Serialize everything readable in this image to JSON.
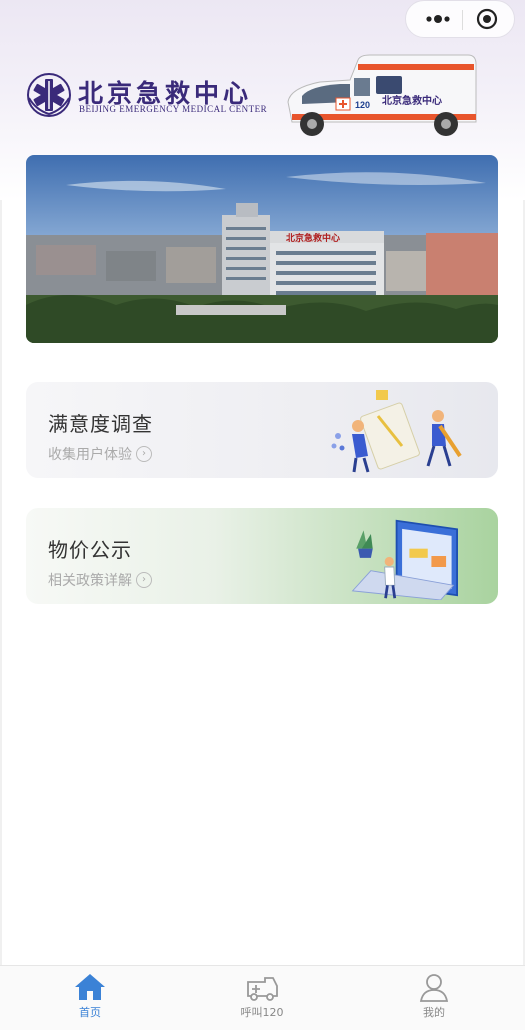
{
  "header": {
    "logo_text_cn": "北京急救中心",
    "logo_text_en": "BEIJING  EMERGENCY  MEDICAL  CENTER",
    "ambulance_text": "北京急救中心",
    "ambulance_number": "120"
  },
  "banner": {
    "building_sign": "北京急救中心"
  },
  "cards": [
    {
      "title": "满意度调查",
      "subtitle": "收集用户体验"
    },
    {
      "title": "物价公示",
      "subtitle": "相关政策详解"
    }
  ],
  "tabbar": {
    "items": [
      {
        "label": "首页",
        "icon": "home-icon",
        "active": true
      },
      {
        "label": "呼叫120",
        "icon": "ambulance-icon",
        "active": false
      },
      {
        "label": "我的",
        "icon": "user-icon",
        "active": false
      }
    ]
  },
  "colors": {
    "brand": "#3a2a7a",
    "accent": "#3b82d6"
  }
}
